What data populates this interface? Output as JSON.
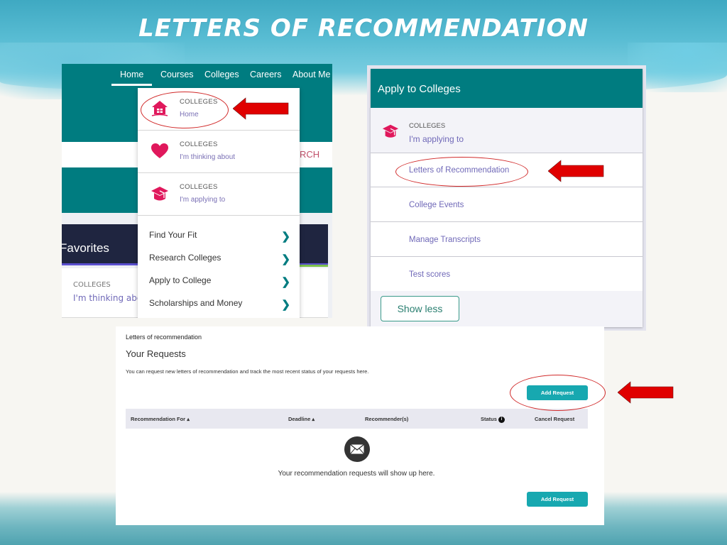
{
  "slide": {
    "title": "LETTERS OF RECOMMENDATION"
  },
  "nav_panel": {
    "nav_items": [
      "Home",
      "Courses",
      "Colleges",
      "Careers",
      "About Me"
    ],
    "active_nav": "Home",
    "partial_search_text": "RCH",
    "favorites_title": "Favorites",
    "favorites_card": {
      "label": "COLLEGES",
      "value": "I'm thinking abo"
    },
    "dropdown": {
      "college_items": [
        {
          "label": "COLLEGES",
          "sub": "Home",
          "icon": "house-icon",
          "highlighted": true
        },
        {
          "label": "COLLEGES",
          "sub": "I'm thinking about",
          "icon": "heart-icon",
          "highlighted": false
        },
        {
          "label": "COLLEGES",
          "sub": "I'm applying to",
          "icon": "graduation-cap-icon",
          "highlighted": false
        }
      ],
      "links": [
        {
          "label": "Find Your Fit",
          "icon": "chevron-right-icon"
        },
        {
          "label": "Research Colleges",
          "icon": "chevron-right-icon"
        },
        {
          "label": "Apply to College",
          "icon": "chevron-right-icon"
        },
        {
          "label": "Scholarships and Money",
          "icon": "chevron-right-icon"
        }
      ]
    }
  },
  "apply_panel": {
    "title": "Apply to Colleges",
    "college_item": {
      "label": "COLLEGES",
      "sub": "I'm applying to",
      "icon": "graduation-cap-icon"
    },
    "rows": [
      {
        "label": "Letters of Recommendation",
        "highlighted": true
      },
      {
        "label": "College Events",
        "highlighted": false
      },
      {
        "label": "Manage Transcripts",
        "highlighted": false
      },
      {
        "label": "Test scores",
        "highlighted": false
      }
    ],
    "show_less_label": "Show less"
  },
  "requests_panel": {
    "breadcrumb": "Letters of recommendation",
    "title": "Your Requests",
    "description": "You can request new letters of recommendation and track the most recent status of your requests here.",
    "add_request_label": "Add Request",
    "table_headers": [
      {
        "label": "Recommendation For",
        "sortable": true
      },
      {
        "label": "Deadline",
        "sortable": true
      },
      {
        "label": "Recommender(s)",
        "sortable": false
      },
      {
        "label": "Status",
        "sortable": false,
        "info": true
      },
      {
        "label": "Cancel Request",
        "sortable": false
      }
    ],
    "sort_glyph": "▴",
    "info_glyph": "i",
    "empty_icon": "envelope-icon",
    "empty_message": "Your recommendation requests will show up here."
  },
  "colors": {
    "teal_brand": "#007c80",
    "button_teal": "#17a8b0",
    "link_purple": "#7069b8",
    "icon_pink": "#e0185c",
    "annotation_red": "#e00000"
  }
}
